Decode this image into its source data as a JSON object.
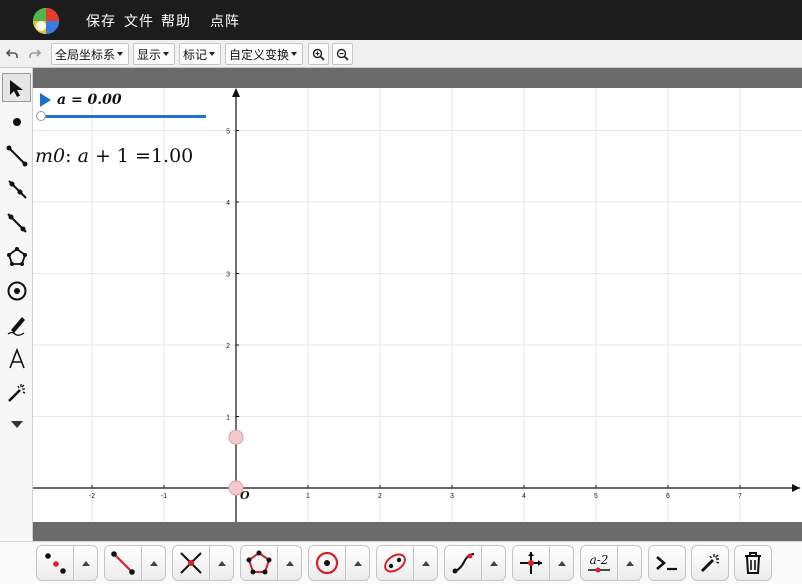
{
  "menu": {
    "items": [
      "保存",
      "文件",
      "帮助",
      "点阵"
    ]
  },
  "toolbar": {
    "undo_icon": "undo-icon",
    "redo_icon": "redo-icon",
    "coord_system_label": "全局坐标系",
    "display_label": "显示",
    "mark_label": "标记",
    "custom_transform_label": "自定义变换",
    "zoom_in_icon": "zoom-in-icon",
    "zoom_out_icon": "zoom-out-icon"
  },
  "left_tools": [
    "select-arrow",
    "point",
    "segment",
    "ray",
    "line",
    "polygon",
    "circle",
    "pen",
    "text",
    "magic-wand",
    "more"
  ],
  "parameter": {
    "label": "a = 0.00",
    "slider_value": 0.0
  },
  "measurement": {
    "name": "m0",
    "expression_var": "a",
    "expression_rest": "+ 1 =",
    "value": "1.00"
  },
  "graph": {
    "origin_label": "O",
    "x_ticks": [
      "-2",
      "-1",
      "1",
      "2",
      "3",
      "4",
      "5",
      "6",
      "7"
    ],
    "y_ticks": [
      "1",
      "2",
      "3",
      "4",
      "5"
    ],
    "points": [
      {
        "x": 0,
        "y": 0
      },
      {
        "x": 0,
        "y": 0.71
      }
    ],
    "point_color": "#f3c9cc",
    "grid_color": "#e6e6e6"
  },
  "bottom_tools": [
    "point-tools",
    "segment-tools",
    "intersection-tools",
    "polygon-tools",
    "circle-tools",
    "conic-tools",
    "function-tools",
    "transform-tools",
    "parameter-tools"
  ],
  "bottom_singles": [
    "command-line",
    "magic-wand",
    "delete"
  ],
  "param_button_label": "a-2",
  "colors": {
    "menubar": "#1c1c1c",
    "accent": "#2172d6",
    "strip": "#6b6b6b"
  }
}
